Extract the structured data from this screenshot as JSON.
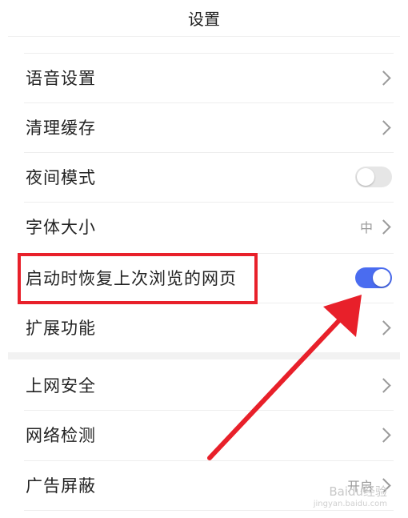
{
  "header": {
    "title": "设置"
  },
  "settings": {
    "voice": {
      "label": "语音设置"
    },
    "cache": {
      "label": "清理缓存"
    },
    "night": {
      "label": "夜间模式",
      "enabled": false
    },
    "font": {
      "label": "字体大小",
      "value": "中"
    },
    "restore": {
      "label": "启动时恢复上次浏览的网页",
      "enabled": true
    },
    "extensions": {
      "label": "扩展功能"
    },
    "security": {
      "label": "上网安全"
    },
    "network": {
      "label": "网络检测"
    },
    "adblock": {
      "label": "广告屏蔽",
      "value": "开启"
    }
  },
  "colors": {
    "toggle_on": "#4a6cf0",
    "annotation": "#e8202a"
  },
  "watermark": {
    "text": "Baidu经验",
    "sub": "jingyan.baidu.com"
  }
}
